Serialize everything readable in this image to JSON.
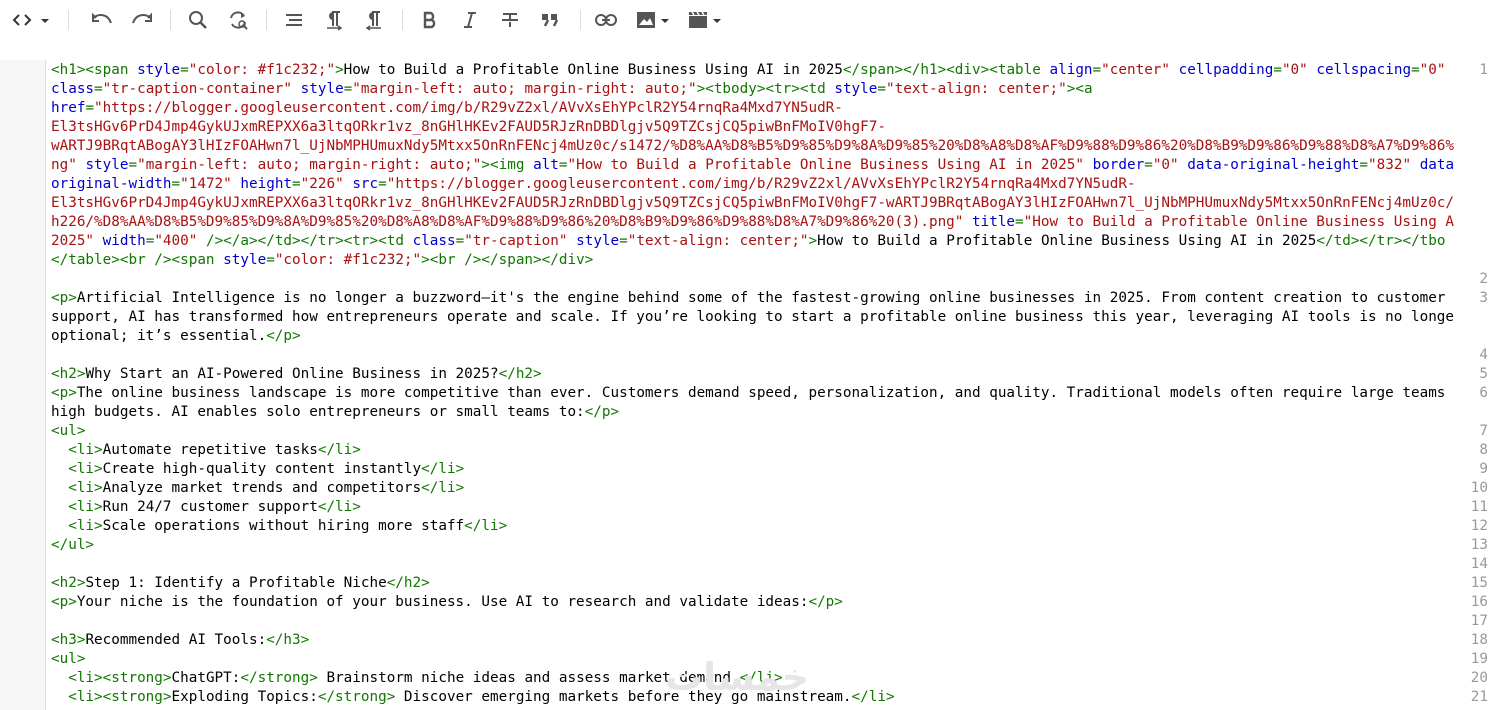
{
  "toolbar": {
    "tools": [
      {
        "name": "code-view-icon"
      },
      {
        "name": "undo-icon"
      },
      {
        "name": "redo-icon"
      },
      {
        "name": "search-icon"
      },
      {
        "name": "replace-icon"
      },
      {
        "name": "format-lines-icon"
      },
      {
        "name": "paragraph-ltr-icon"
      },
      {
        "name": "paragraph-rtl-icon"
      },
      {
        "name": "bold-icon"
      },
      {
        "name": "italic-icon"
      },
      {
        "name": "strikethrough-icon"
      },
      {
        "name": "quote-icon"
      },
      {
        "name": "link-icon"
      },
      {
        "name": "image-icon"
      },
      {
        "name": "video-icon"
      }
    ]
  },
  "editor": {
    "gutter_numbers": [
      "1",
      "2",
      "3",
      "4",
      "5",
      "6",
      "7",
      "8",
      "9",
      "10",
      "11",
      "12",
      "13",
      "14",
      "15",
      "16",
      "17",
      "18",
      "19",
      "20",
      "21"
    ],
    "lines": [
      {
        "n": "1",
        "segs": [
          [
            "t",
            "<h1><span "
          ],
          [
            "a",
            "style"
          ],
          [
            "t",
            "="
          ],
          [
            "s",
            "\"color: #f1c232;\""
          ],
          [
            "t",
            ">"
          ],
          [
            "x",
            "How to Build a Profitable Online Business Using AI in 2025"
          ],
          [
            "t",
            "</span></h1><div><table "
          ],
          [
            "a",
            "align"
          ],
          [
            "t",
            "="
          ],
          [
            "s",
            "\"center\""
          ],
          [
            "x",
            " "
          ],
          [
            "a",
            "cellpadding"
          ],
          [
            "t",
            "="
          ],
          [
            "s",
            "\"0\""
          ],
          [
            "x",
            " "
          ],
          [
            "a",
            "cellspacing"
          ],
          [
            "t",
            "="
          ],
          [
            "s",
            "\"0\""
          ]
        ]
      },
      {
        "n": "",
        "segs": [
          [
            "a",
            "class"
          ],
          [
            "t",
            "="
          ],
          [
            "s",
            "\"tr-caption-container\""
          ],
          [
            "x",
            " "
          ],
          [
            "a",
            "style"
          ],
          [
            "t",
            "="
          ],
          [
            "s",
            "\"margin-left: auto; margin-right: auto;\""
          ],
          [
            "t",
            "><tbody><tr><td "
          ],
          [
            "a",
            "style"
          ],
          [
            "t",
            "="
          ],
          [
            "s",
            "\"text-align: center;\""
          ],
          [
            "t",
            "><a"
          ]
        ]
      },
      {
        "n": "",
        "segs": [
          [
            "a",
            "href"
          ],
          [
            "t",
            "="
          ],
          [
            "s",
            "\"https://blogger.googleusercontent.com/img/b/R29vZ2xl/AVvXsEhYPclR2Y54rnqRa4Mxd7YN5udR-"
          ]
        ]
      },
      {
        "n": "",
        "segs": [
          [
            "s",
            "El3tsHGv6PrD4Jmp4GykUJxmREPXX6a3ltqORkr1vz_8nGHlHKEv2FAUD5RJzRnDBDlgjv5Q9TZCsjCQ5piwBnFMoIV0hgF7-"
          ]
        ]
      },
      {
        "n": "",
        "segs": [
          [
            "s",
            "wARTJ9BRqtABogAY3lHIzFOAHwn7l_UjNbMPHUmuxNdy5Mtxx5OnRnFENcj4mUz0c/s1472/%D8%AA%D8%B5%D9%85%D9%8A%D9%85%20%D8%A8%D8%AF%D9%88%D9%86%20%D8%B9%D9%86%D9%88%D8%A7%D9%86%"
          ]
        ]
      },
      {
        "n": "",
        "segs": [
          [
            "s",
            "ng\""
          ],
          [
            "x",
            " "
          ],
          [
            "a",
            "style"
          ],
          [
            "t",
            "="
          ],
          [
            "s",
            "\"margin-left: auto; margin-right: auto;\""
          ],
          [
            "t",
            "><img "
          ],
          [
            "a",
            "alt"
          ],
          [
            "t",
            "="
          ],
          [
            "s",
            "\"How to Build a Profitable Online Business Using AI in 2025\""
          ],
          [
            "x",
            " "
          ],
          [
            "a",
            "border"
          ],
          [
            "t",
            "="
          ],
          [
            "s",
            "\"0\""
          ],
          [
            "x",
            " "
          ],
          [
            "a",
            "data-original-height"
          ],
          [
            "t",
            "="
          ],
          [
            "s",
            "\"832\""
          ],
          [
            "x",
            " "
          ],
          [
            "a",
            "data"
          ]
        ]
      },
      {
        "n": "",
        "segs": [
          [
            "a",
            "original-width"
          ],
          [
            "t",
            "="
          ],
          [
            "s",
            "\"1472\""
          ],
          [
            "x",
            " "
          ],
          [
            "a",
            "height"
          ],
          [
            "t",
            "="
          ],
          [
            "s",
            "\"226\""
          ],
          [
            "x",
            " "
          ],
          [
            "a",
            "src"
          ],
          [
            "t",
            "="
          ],
          [
            "s",
            "\"https://blogger.googleusercontent.com/img/b/R29vZ2xl/AVvXsEhYPclR2Y54rnqRa4Mxd7YN5udR-"
          ]
        ]
      },
      {
        "n": "",
        "segs": [
          [
            "s",
            "El3tsHGv6PrD4Jmp4GykUJxmREPXX6a3ltqORkr1vz_8nGHlHKEv2FAUD5RJzRnDBDlgjv5Q9TZCsjCQ5piwBnFMoIV0hgF7-wARTJ9BRqtABogAY3lHIzFOAHwn7l_UjNbMPHUmuxNdy5Mtxx5OnRnFENcj4mUz0c/"
          ]
        ]
      },
      {
        "n": "",
        "segs": [
          [
            "s",
            "h226/%D8%AA%D8%B5%D9%85%D9%8A%D9%85%20%D8%A8%D8%AF%D9%88%D9%86%20%D8%B9%D9%86%D9%88%D8%A7%D9%86%20(3).png\""
          ],
          [
            "x",
            " "
          ],
          [
            "a",
            "title"
          ],
          [
            "t",
            "="
          ],
          [
            "s",
            "\"How to Build a Profitable Online Business Using A"
          ]
        ]
      },
      {
        "n": "",
        "segs": [
          [
            "s",
            "2025\""
          ],
          [
            "x",
            " "
          ],
          [
            "a",
            "width"
          ],
          [
            "t",
            "="
          ],
          [
            "s",
            "\"400\""
          ],
          [
            "x",
            " "
          ],
          [
            "t",
            "/></a></td></tr><tr><td "
          ],
          [
            "a",
            "class"
          ],
          [
            "t",
            "="
          ],
          [
            "s",
            "\"tr-caption\""
          ],
          [
            "x",
            " "
          ],
          [
            "a",
            "style"
          ],
          [
            "t",
            "="
          ],
          [
            "s",
            "\"text-align: center;\""
          ],
          [
            "t",
            ">"
          ],
          [
            "x",
            "How to Build a Profitable Online Business Using AI in 2025"
          ],
          [
            "t",
            "</td></tr></tbo"
          ]
        ]
      },
      {
        "n": "",
        "segs": [
          [
            "t",
            "</table><br /><span "
          ],
          [
            "a",
            "style"
          ],
          [
            "t",
            "="
          ],
          [
            "s",
            "\"color: #f1c232;\""
          ],
          [
            "t",
            "><br /></span></div>"
          ]
        ]
      },
      {
        "n": "2",
        "segs": []
      },
      {
        "n": "3",
        "segs": [
          [
            "t",
            "<p>"
          ],
          [
            "x",
            "Artificial Intelligence is no longer a buzzword—it's the engine behind some of the fastest-growing online businesses in 2025. From content creation to customer"
          ]
        ]
      },
      {
        "n": "",
        "segs": [
          [
            "x",
            "support, AI has transformed how entrepreneurs operate and scale. If you’re looking to start a profitable online business this year, leveraging AI tools is no longe"
          ]
        ]
      },
      {
        "n": "",
        "segs": [
          [
            "x",
            "optional; it’s essential."
          ],
          [
            "t",
            "</p>"
          ]
        ]
      },
      {
        "n": "4",
        "segs": []
      },
      {
        "n": "5",
        "segs": [
          [
            "t",
            "<h2>"
          ],
          [
            "x",
            "Why Start an AI-Powered Online Business in 2025?"
          ],
          [
            "t",
            "</h2>"
          ]
        ]
      },
      {
        "n": "6",
        "segs": [
          [
            "t",
            "<p>"
          ],
          [
            "x",
            "The online business landscape is more competitive than ever. Customers demand speed, personalization, and quality. Traditional models often require large teams"
          ]
        ]
      },
      {
        "n": "",
        "segs": [
          [
            "x",
            "high budgets. AI enables solo entrepreneurs or small teams to:"
          ],
          [
            "t",
            "</p>"
          ]
        ]
      },
      {
        "n": "7",
        "segs": [
          [
            "t",
            "<ul>"
          ]
        ]
      },
      {
        "n": "8",
        "segs": [
          [
            "x",
            "  "
          ],
          [
            "t",
            "<li>"
          ],
          [
            "x",
            "Automate repetitive tasks"
          ],
          [
            "t",
            "</li>"
          ]
        ]
      },
      {
        "n": "9",
        "segs": [
          [
            "x",
            "  "
          ],
          [
            "t",
            "<li>"
          ],
          [
            "x",
            "Create high-quality content instantly"
          ],
          [
            "t",
            "</li>"
          ]
        ]
      },
      {
        "n": "10",
        "segs": [
          [
            "x",
            "  "
          ],
          [
            "t",
            "<li>"
          ],
          [
            "x",
            "Analyze market trends and competitors"
          ],
          [
            "t",
            "</li>"
          ]
        ]
      },
      {
        "n": "11",
        "segs": [
          [
            "x",
            "  "
          ],
          [
            "t",
            "<li>"
          ],
          [
            "x",
            "Run 24/7 customer support"
          ],
          [
            "t",
            "</li>"
          ]
        ]
      },
      {
        "n": "12",
        "segs": [
          [
            "x",
            "  "
          ],
          [
            "t",
            "<li>"
          ],
          [
            "x",
            "Scale operations without hiring more staff"
          ],
          [
            "t",
            "</li>"
          ]
        ]
      },
      {
        "n": "13",
        "segs": [
          [
            "t",
            "</ul>"
          ]
        ]
      },
      {
        "n": "14",
        "segs": []
      },
      {
        "n": "15",
        "segs": [
          [
            "t",
            "<h2>"
          ],
          [
            "x",
            "Step 1: Identify a Profitable Niche"
          ],
          [
            "t",
            "</h2>"
          ]
        ]
      },
      {
        "n": "16",
        "segs": [
          [
            "t",
            "<p>"
          ],
          [
            "x",
            "Your niche is the foundation of your business. Use AI to research and validate ideas:"
          ],
          [
            "t",
            "</p>"
          ]
        ]
      },
      {
        "n": "17",
        "segs": []
      },
      {
        "n": "18",
        "segs": [
          [
            "t",
            "<h3>"
          ],
          [
            "x",
            "Recommended AI Tools:"
          ],
          [
            "t",
            "</h3>"
          ]
        ]
      },
      {
        "n": "19",
        "segs": [
          [
            "t",
            "<ul>"
          ]
        ]
      },
      {
        "n": "20",
        "segs": [
          [
            "x",
            "  "
          ],
          [
            "t",
            "<li><strong>"
          ],
          [
            "x",
            "ChatGPT:"
          ],
          [
            "t",
            "</strong>"
          ],
          [
            "x",
            " Brainstorm niche ideas and assess market demand."
          ],
          [
            "t",
            "</li>"
          ]
        ]
      },
      {
        "n": "21",
        "segs": [
          [
            "x",
            "  "
          ],
          [
            "t",
            "<li><strong>"
          ],
          [
            "x",
            "Exploding Topics:"
          ],
          [
            "t",
            "</strong>"
          ],
          [
            "x",
            " Discover emerging markets before they go mainstream."
          ],
          [
            "t",
            "</li>"
          ]
        ]
      }
    ]
  },
  "watermark": {
    "text": "خمسات"
  }
}
